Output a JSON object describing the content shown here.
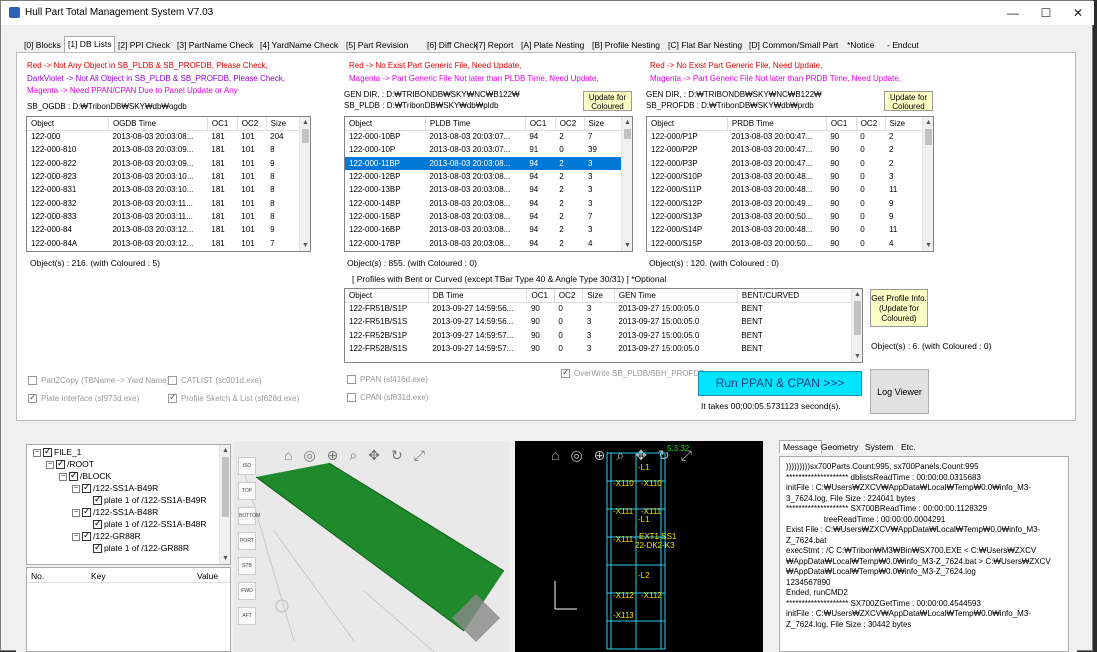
{
  "window": {
    "title": "Hull Part Total Management System V7.03",
    "minimize": "—",
    "maximize": "☐",
    "close": "✕"
  },
  "tabs": [
    "[0] Blocks",
    "[1] DB Lists",
    "[2] PPI Check",
    "[3] PartName Check",
    "[4] YardName Check",
    "[5] Part Revision",
    "[6] Diff Check",
    "[7] Report",
    "[A] Plate Nesting",
    "[B] Profile Nesting",
    "[C] Flat Bar Nesting",
    "[D] Common/Small Part",
    "*Notice",
    "- Endcut"
  ],
  "legend1": {
    "red": "Red       -> Not Any Object in SB_PLDB & SB_PROFDB, Please Check,",
    "vio": "DarkViolet -> Not All Object in SB_PLDB & SB_PROFDB, Please Check,",
    "mag": "Magenta    -> Need PPAN/CPAN Due to Panel Update or Any"
  },
  "legend2": {
    "red": "Red -> No Exist Part Generic File, Need Update,",
    "mag": "Magenta   -> Part Generic File Not later than PLDB Time, Need Update,"
  },
  "legend3": {
    "red": "Red -> No Exist Part Generic File, Need Update,",
    "mag": "Magenta   -> Part Generic File Not later than PRDB Time, Need Update,"
  },
  "paths": {
    "ogdb": "SB_OGDB : D:₩TribonDB₩SKY₩db₩ogdb",
    "gen1": "GEN DIR, : D:₩TRIBONDB₩SKY₩NC₩B122₩",
    "pldb": "SB_PLDB : D:₩TribonDB₩SKY₩db₩pldb",
    "gen2": "GEN DIR, : D:₩TRIBONDB₩SKY₩NC₩B122₩",
    "prdb": "SB_PROFDB : D:₩TribonDB₩SKY₩db₩prdb"
  },
  "update_label": "Update for Coloured",
  "ogdb": {
    "headers": [
      "Object",
      "OGDB Time",
      "OC1",
      "OC2",
      "Size"
    ],
    "rows": [
      [
        "122-000",
        "2013-08-03 20:03:08...",
        "181",
        "101",
        "204"
      ],
      [
        "122-000-810",
        "2013-08-03 20:03:09...",
        "181",
        "101",
        "8"
      ],
      [
        "122-000-822",
        "2013-08-03 20:03:09...",
        "181",
        "101",
        "9"
      ],
      [
        "122-000-823",
        "2013-08-03 20:03:10...",
        "181",
        "101",
        "8"
      ],
      [
        "122-000-831",
        "2013-08-03 20:03:10...",
        "181",
        "101",
        "8"
      ],
      [
        "122-000-832",
        "2013-08-03 20:03:11...",
        "181",
        "101",
        "8"
      ],
      [
        "122-000-833",
        "2013-08-03 20:03:11...",
        "181",
        "101",
        "8"
      ],
      [
        "122-000-84",
        "2013-08-03 20:03:12...",
        "181",
        "101",
        "9"
      ],
      [
        "122-000-84A",
        "2013-08-03 20:03:12...",
        "181",
        "101",
        "7"
      ]
    ],
    "count": "Object(s) : 216. (with Coloured : 5)"
  },
  "pldb": {
    "headers": [
      "Object",
      "PLDB Time",
      "OC1",
      "OC2",
      "Size"
    ],
    "rows": [
      [
        "122-000-10BP",
        "2013-08-03 20:03:07...",
        "94",
        "2",
        "7"
      ],
      [
        "122-000-10P",
        "2013-08-03 20:03:07...",
        "91",
        "0",
        "39"
      ],
      [
        "122-000-11BP",
        "2013-08-03 20:03:08...",
        "94",
        "2",
        "3"
      ],
      [
        "122-000-12BP",
        "2013-08-03 20:03:08...",
        "94",
        "2",
        "3"
      ],
      [
        "122-000-13BP",
        "2013-08-03 20:03:08...",
        "94",
        "2",
        "3"
      ],
      [
        "122-000-14BP",
        "2013-08-03 20:03:08...",
        "94",
        "2",
        "3"
      ],
      [
        "122-000-15BP",
        "2013-08-03 20:03:08...",
        "94",
        "2",
        "7"
      ],
      [
        "122-000-16BP",
        "2013-08-03 20:03:08...",
        "94",
        "2",
        "3"
      ],
      [
        "122-000-17BP",
        "2013-08-03 20:03:08...",
        "94",
        "2",
        "4"
      ]
    ],
    "count": "Object(s) : 855. (with Coloured : 0)"
  },
  "prdb": {
    "headers": [
      "Object",
      "PRDB Time",
      "OC1",
      "OC2",
      "Size"
    ],
    "rows": [
      [
        "122-000/P1P",
        "2013-08-03 20:00:47...",
        "90",
        "0",
        "2"
      ],
      [
        "122-000/P2P",
        "2013-08-03 20:00:47...",
        "90",
        "0",
        "2"
      ],
      [
        "122-000/P3P",
        "2013-08-03 20:00:47...",
        "90",
        "0",
        "2"
      ],
      [
        "122-000/S10P",
        "2013-08-03 20:00:48...",
        "90",
        "0",
        "3"
      ],
      [
        "122-000/S11P",
        "2013-08-03 20:00:48...",
        "90",
        "0",
        "11"
      ],
      [
        "122-000/S12P",
        "2013-08-03 20:00:49...",
        "90",
        "0",
        "9"
      ],
      [
        "122-000/S13P",
        "2013-08-03 20:00:50...",
        "90",
        "0",
        "9"
      ],
      [
        "122-000/S14P",
        "2013-08-03 20:00:48...",
        "90",
        "0",
        "11"
      ],
      [
        "122-000/S15P",
        "2013-08-03 20:00:50...",
        "90",
        "0",
        "4"
      ]
    ],
    "count": "Object(s) : 120. (with Coloured : 0)"
  },
  "profiles": {
    "caption": "[ Profiles with Bent or Curved (except TBar Type 40 & Angle Type 30/31) ] *Optional",
    "headers": [
      "Object",
      "DB Time",
      "OC1",
      "OC2",
      "Size",
      "GEN Time",
      "BENT/CURVED"
    ],
    "rows": [
      [
        "122-FR51B/S1P",
        "2013-09-27 14:59:56...",
        "90",
        "0",
        "3",
        "2013-09-27 15:00:05.0",
        "BENT"
      ],
      [
        "122-FR51B/S1S",
        "2013-09-27 14:59:56...",
        "90",
        "0",
        "3",
        "2013-09-27 15:00:05.0",
        "BENT"
      ],
      [
        "122-FR52B/S1P",
        "2013-09-27 14:59:57...",
        "90",
        "0",
        "3",
        "2013-09-27 15:00:05.0",
        "BENT"
      ],
      [
        "122-FR52B/S1S",
        "2013-09-27 14:59:57...",
        "90",
        "0",
        "3",
        "2013-09-27 15:00:05.0",
        "BENT"
      ]
    ],
    "button": "Get Profile Info. (Update for Coloured)",
    "count": "Object(s) : 6. (with Coloured : 0)"
  },
  "options": {
    "part2copy": "Part2Copy (TBName -> Yard Name)",
    "catlist": "CATLIST (sc001d.exe)",
    "plate_interface": "Plate Interface (sf973d.exe)",
    "profile_sketch": "Profile Sketch & List (sf628d.exe)",
    "ppan": "PPAN (sf416d.exe)",
    "cpan": "CPAN (sf831d.exe)",
    "overwrite": "OverWrite SB_PLDB/SBH_PROFDB"
  },
  "run_button": "Run PPAN & CPAN >>>",
  "run_time": "It takes 00:00:05.5731123 second(s).",
  "log_viewer": "Log Viewer",
  "tree": {
    "nodes": [
      "FILE_1",
      "/ROOT",
      "/BLOCK",
      "/122-SS1A-B49R",
      "plate 1 of /122-SS1A-B49R",
      "/122-SS1A-B48R",
      "plate 1 of /122-SS1A-B48R",
      "/122-GR88R",
      "plate 1 of /122-GR88R"
    ]
  },
  "props": {
    "headers": [
      "No.",
      "Key",
      "Value"
    ]
  },
  "viewbtns": [
    "ISO",
    "TOP",
    "BOTTOM",
    "PORT",
    "STB",
    "FWD",
    "AFT"
  ],
  "view2d": {
    "labels": [
      "-X110",
      "-X111",
      "-X111",
      "-X112",
      "-X113",
      "-L1",
      "-L2",
      "-L1",
      "-X110",
      "-X111",
      "-X112",
      "22-DK2-K3",
      "EXT1 SS1"
    ],
    "top_label": "5.3 32"
  },
  "messages": {
    "tabs": [
      "Message",
      "Geometry",
      "System",
      "Etc."
    ],
    "lines": [
      ")))))))))sx700Parts.Count:995, sx700Panels.Count:995",
      "******************** dblistsReadTime : 00:00:00.0315683",
      "initFile : C:₩Users₩ZXCV₩AppData₩Local₩Temp₩0.0₩info_M3-",
      "3_7624.log, File Size : 224041 bytes",
      "******************** SX700BReadTime : 00:00:00.1128329",
      "                 treeReadTime : 00:00:00.0004291",
      "Exist File : C:₩Users₩ZXCV₩AppData₩Local₩Temp₩0.0₩info_M3-",
      "Z_7624.bat",
      "execStmt : /C C:₩Tribon₩M3₩Bin₩SX700.EXE < C:₩Users₩ZXCV",
      "₩AppData₩Local₩Temp₩0.0₩info_M3-Z_7624.bat > C:₩Users₩ZXCV",
      "₩AppData₩Local₩Temp₩0.0₩info_M3-Z_7624.log",
      "1234567890",
      "Ended, runCMD2",
      "******************** SX700ZGetTime : 00:00:00.4544593",
      "initFile : C:₩Users₩ZXCV₩AppData₩Local₩Temp₩0.0₩info_M3-",
      "Z_7624.log, File Size : 30442 bytes"
    ]
  }
}
